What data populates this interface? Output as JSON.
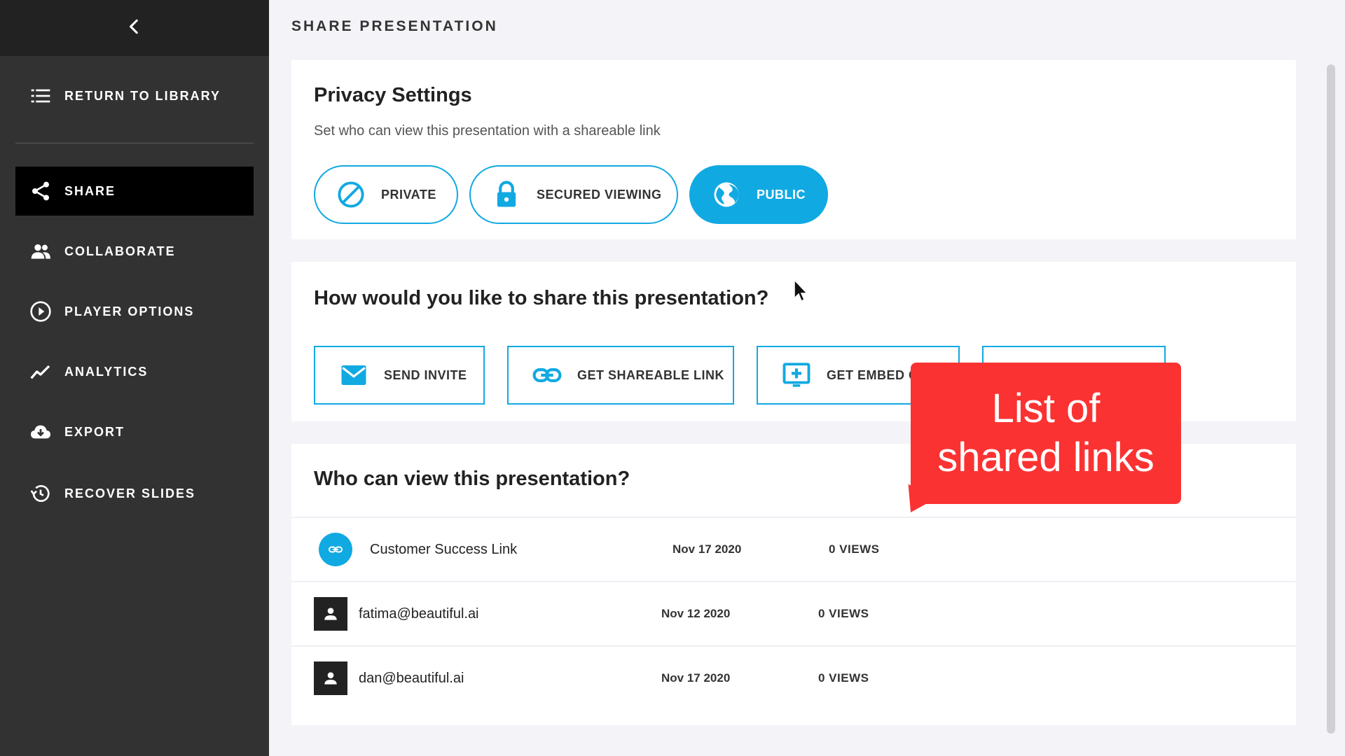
{
  "sidebar": {
    "back_icon": "chevron-left-icon",
    "items": [
      {
        "label": "RETURN TO LIBRARY",
        "icon": "list-icon"
      },
      {
        "label": "SHARE",
        "icon": "share-icon"
      },
      {
        "label": "COLLABORATE",
        "icon": "people-icon"
      },
      {
        "label": "PLAYER OPTIONS",
        "icon": "play-circle-icon"
      },
      {
        "label": "ANALYTICS",
        "icon": "trend-line-icon"
      },
      {
        "label": "EXPORT",
        "icon": "cloud-download-icon"
      },
      {
        "label": "RECOVER SLIDES",
        "icon": "history-icon"
      }
    ],
    "active": "SHARE"
  },
  "page_title": "SHARE PRESENTATION",
  "privacy": {
    "title": "Privacy Settings",
    "subtitle": "Set who can view this presentation with a shareable link",
    "options": [
      {
        "label": "PRIVATE",
        "icon": "block-icon"
      },
      {
        "label": "SECURED VIEWING",
        "icon": "lock-icon"
      },
      {
        "label": "PUBLIC",
        "icon": "globe-icon"
      }
    ],
    "selected": "PUBLIC"
  },
  "share": {
    "title": "How would you like to share this presentation?",
    "buttons": [
      {
        "label": "SEND INVITE",
        "icon": "mail-icon"
      },
      {
        "label": "GET SHAREABLE LINK",
        "icon": "link-icon"
      },
      {
        "label": "GET EMBED C",
        "icon": "embed-icon"
      }
    ]
  },
  "viewers": {
    "title": "Who can view this presentation?",
    "rows": [
      {
        "name": "Customer Success Link",
        "date": "Nov 17 2020",
        "views": "0 VIEWS",
        "type": "link"
      },
      {
        "name": "fatima@beautiful.ai",
        "date": "Nov 12 2020",
        "views": "0 VIEWS",
        "type": "user"
      },
      {
        "name": "dan@beautiful.ai",
        "date": "Nov 17 2020",
        "views": "0 VIEWS",
        "type": "user"
      }
    ]
  },
  "callout": {
    "line1": "List of",
    "line2": "shared links"
  },
  "colors": {
    "accent": "#11a9e2",
    "sidebar": "#323232",
    "callout": "#fb3232"
  }
}
